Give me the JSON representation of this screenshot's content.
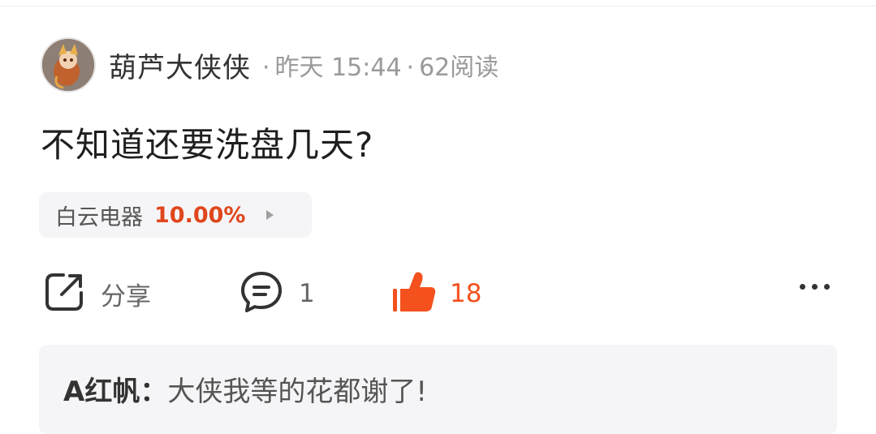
{
  "post": {
    "author": "葫芦大侠侠",
    "time": "昨天 15:44",
    "reads": "62阅读",
    "separator": "·",
    "title": "不知道还要洗盘几天?"
  },
  "stock": {
    "name": "白云电器",
    "change": "10.00%",
    "change_color": "#e0461d"
  },
  "actions": {
    "share_label": "分享",
    "comment_count": "1",
    "like_count": "18",
    "like_color": "#f4511e",
    "icon_color": "#333333"
  },
  "icons": {
    "share": "share-icon",
    "comment": "comment-bubble-icon",
    "like": "thumbs-up-icon",
    "more": "more-dots-icon",
    "chip_arrow": "triangle-right-icon"
  },
  "comment": {
    "author": "A红帆：",
    "text": "大侠我等的花都谢了!"
  }
}
